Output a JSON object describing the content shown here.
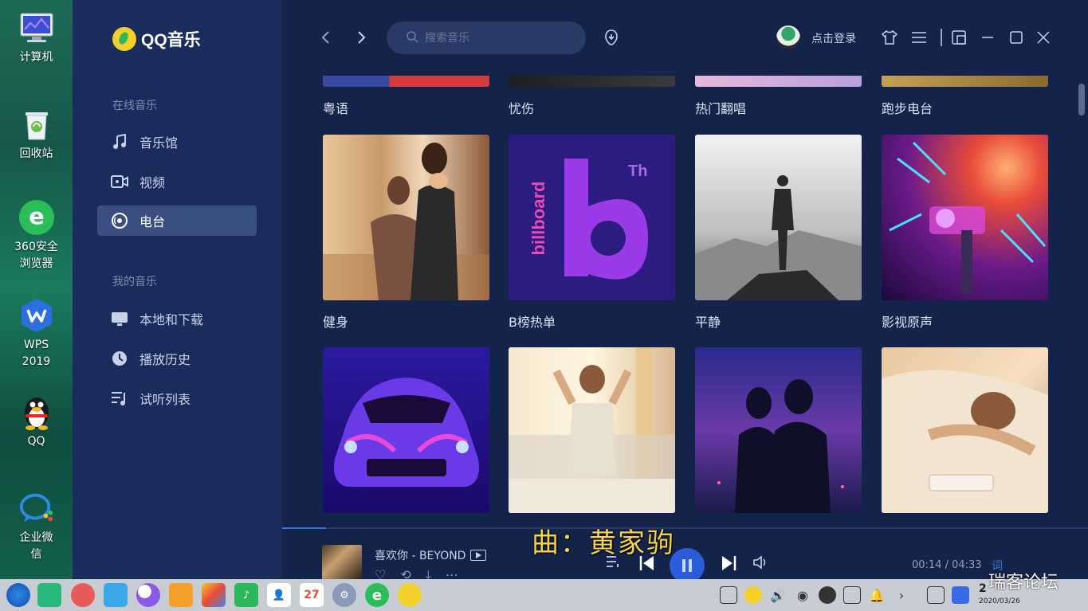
{
  "desktop": {
    "icons": [
      {
        "label": "计算机",
        "icon": "computer-icon"
      },
      {
        "label": "回收站",
        "icon": "recycle-bin-icon"
      },
      {
        "label": "360安全\n浏览器",
        "icon": "browser-360-icon"
      },
      {
        "label": "WPS\n2019",
        "icon": "wps-icon"
      },
      {
        "label": "QQ",
        "icon": "qq-penguin-icon"
      },
      {
        "label": "企业微\n信",
        "icon": "wecom-icon"
      }
    ]
  },
  "app": {
    "name": "QQ音乐",
    "sidebar": {
      "section_online": "在线音乐",
      "section_mine": "我的音乐",
      "online_items": [
        {
          "label": "音乐馆",
          "icon": "music-note-icon"
        },
        {
          "label": "视频",
          "icon": "video-camera-icon"
        },
        {
          "label": "电台",
          "icon": "radio-icon",
          "active": true
        }
      ],
      "mine_items": [
        {
          "label": "本地和下载",
          "icon": "monitor-icon"
        },
        {
          "label": "播放历史",
          "icon": "history-clock-icon"
        },
        {
          "label": "试听列表",
          "icon": "playlist-icon"
        }
      ]
    },
    "topbar": {
      "search_placeholder": "搜索音乐",
      "login_label": "点击登录"
    },
    "grid": {
      "partial_row": [
        "粤语",
        "忧伤",
        "热门翻唱",
        "跑步电台"
      ],
      "row1": [
        "健身",
        "B榜热单",
        "平静",
        "影视原声"
      ],
      "billboard_text": "billboard",
      "billboard_mark": "Th"
    },
    "player": {
      "song": "喜欢你 - BEYOND",
      "time": "00:14 / 04:33",
      "lyric_btn": "词",
      "lyric_overlay": [
        "曲：",
        "黄家驹"
      ]
    }
  },
  "taskbar": {
    "calendar_day": "27",
    "clock_time": "2",
    "clock_date": "2020/03/26"
  },
  "watermark": "瑞客论坛",
  "colors": {
    "accent": "#2a5bd8",
    "sidebar": "#1a2c5c",
    "main_bg": "#13234a",
    "lyric": "#f6d446"
  }
}
